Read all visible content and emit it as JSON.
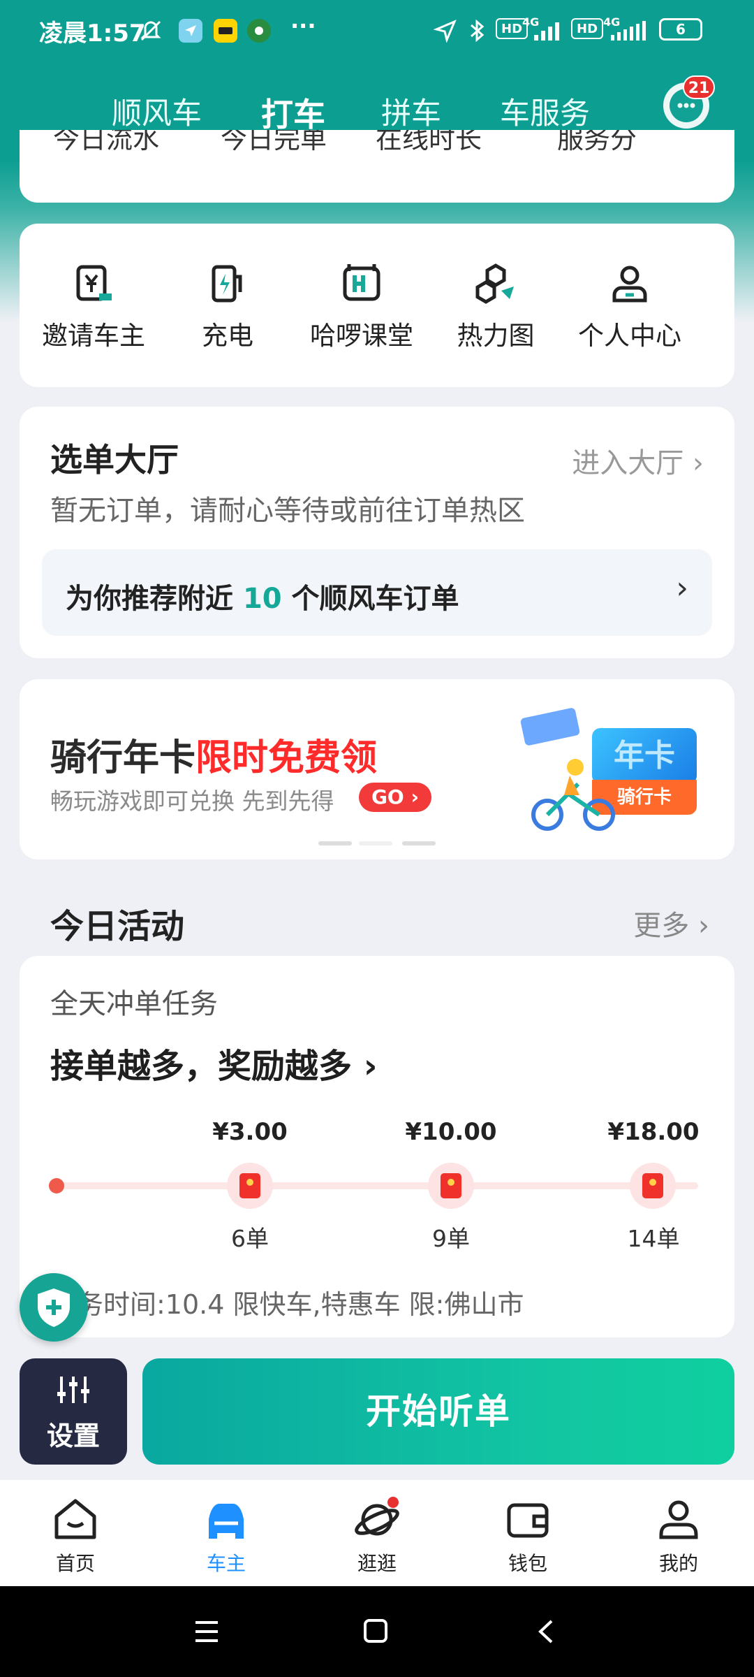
{
  "status_bar": {
    "time": "凌晨1:57",
    "network_1": "4G",
    "network_2": "4G",
    "hd_1": "HD",
    "hd_2": "HD",
    "battery": "6",
    "more": "···"
  },
  "top_tabs": [
    {
      "label": "顺风车"
    },
    {
      "label": "打车"
    },
    {
      "label": "拼车"
    },
    {
      "label": "车服务"
    }
  ],
  "message_badge": "21",
  "stats": [
    "今日流水",
    "今日完单",
    "在线时长",
    "服务分"
  ],
  "quick_actions": [
    {
      "label": "邀请车主",
      "icon": "invite-icon"
    },
    {
      "label": "充电",
      "icon": "charge-icon"
    },
    {
      "label": "哈啰课堂",
      "icon": "classroom-icon"
    },
    {
      "label": "热力图",
      "icon": "heatmap-icon"
    },
    {
      "label": "个人中心",
      "icon": "profile-icon"
    }
  ],
  "order_hall": {
    "title": "选单大厅",
    "enter": "进入大厅",
    "subtitle": "暂无订单，请耐心等待或前往订单热区",
    "recommend_prefix": "为你推荐附近",
    "recommend_count": "10",
    "recommend_suffix": "个顺风车订单"
  },
  "banner": {
    "title_main": "骑行年卡",
    "title_highlight": "限时免费领",
    "subtitle": "畅玩游戏即可兑换 先到先得",
    "go": "GO",
    "card_label_1": "年卡",
    "card_label_2": "骑行卡"
  },
  "activities": {
    "heading": "今日活动",
    "more": "更多",
    "task_title": "全天冲单任务",
    "task_slogan": "接单越多，奖励越多",
    "milestones": [
      {
        "amount": "¥3.00",
        "orders": "6单"
      },
      {
        "amount": "¥10.00",
        "orders": "9单"
      },
      {
        "amount": "¥18.00",
        "orders": "14单"
      }
    ],
    "task_info": "任务时间:10.4 限快车,特惠车 限:佛山市"
  },
  "actions": {
    "settings": "设置",
    "start": "开始听单"
  },
  "bottom_nav": [
    {
      "label": "首页",
      "icon": "home-icon"
    },
    {
      "label": "车主",
      "icon": "car-icon"
    },
    {
      "label": "逛逛",
      "icon": "planet-icon"
    },
    {
      "label": "钱包",
      "icon": "wallet-icon"
    },
    {
      "label": "我的",
      "icon": "user-icon"
    }
  ],
  "colors": {
    "brand_teal": "#0d9e92",
    "accent_red": "#ff2a2a",
    "nav_active": "#1e90ff"
  }
}
